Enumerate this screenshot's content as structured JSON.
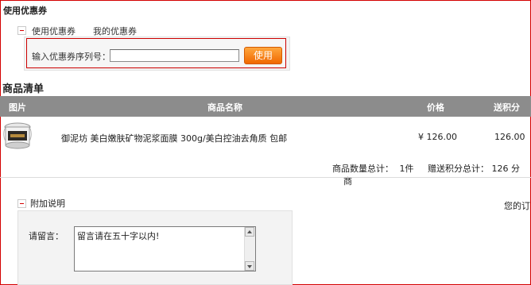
{
  "coupon": {
    "section_title": "使用优惠券",
    "tabs": [
      "使用优惠券",
      "我的优惠券"
    ],
    "input_label": "输入优惠券序列号：",
    "input_value": "",
    "button_label": "使用"
  },
  "goods": {
    "section_title": "商品清单",
    "columns": [
      "图片",
      "商品名称",
      "价格",
      "送积分"
    ],
    "rows": [
      {
        "name": "御泥坊 美白嫩肤矿物泥浆面膜 300g/美白控油去角质 包邮",
        "price": "¥ 126.00",
        "points": "126.00"
      }
    ],
    "summary": {
      "count_label": "商品数量总计：",
      "count_value": "1件",
      "points_label": "赠送积分总计：",
      "points_value": "126 分",
      "trailing": "商"
    }
  },
  "note": {
    "section_title": "附加说明",
    "label": "请留言：",
    "textarea_value": "留言请在五十字以内!",
    "right_text": "您的订"
  },
  "colors": {
    "accent": "#d40000",
    "button": "#f06800",
    "header_bg": "#8c8c8c"
  }
}
